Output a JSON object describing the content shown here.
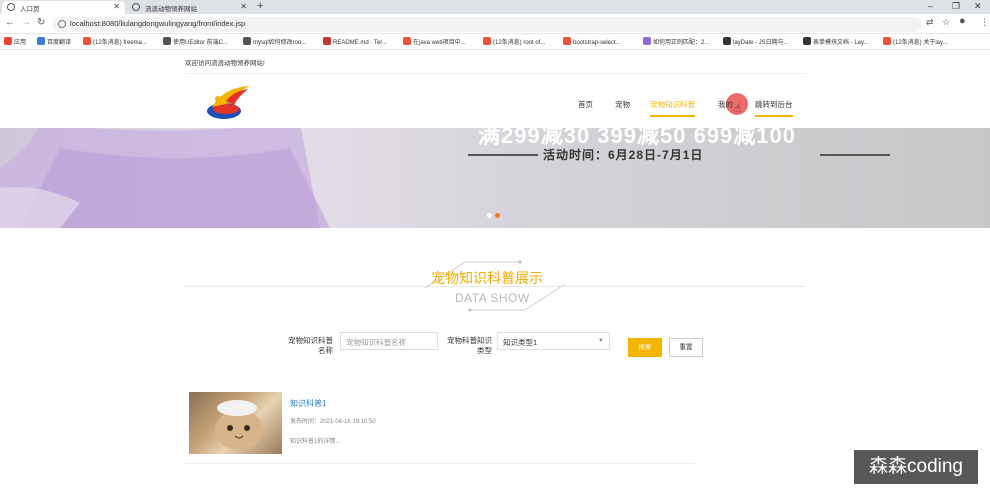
{
  "browser": {
    "tabs": [
      {
        "label": "入口页",
        "active": true
      },
      {
        "label": "流浪动物领养网站",
        "active": false
      }
    ],
    "url": "localhost:8080/liulangdongwulingyang/front/index.jsp",
    "bookmarks": [
      {
        "label": "应用",
        "color": "#ea4335"
      },
      {
        "label": "百度翻译",
        "color": "#3b7bd9"
      },
      {
        "label": "(12条消息) freema...",
        "color": "#e8543c"
      },
      {
        "label": "使用UEditor 前端C...",
        "color": "#555555"
      },
      {
        "label": "mysql如何修改roo...",
        "color": "#555555"
      },
      {
        "label": "README.md · Ter...",
        "color": "#c0392b"
      },
      {
        "label": "在java web项目中...",
        "color": "#e8543c"
      },
      {
        "label": "(12条消息) root of...",
        "color": "#e8543c"
      },
      {
        "label": "bootstrap-select...",
        "color": "#e8543c"
      },
      {
        "label": "如何用正则匹配：2...",
        "color": "#8e6bd6"
      },
      {
        "label": "layDate - JS日期与...",
        "color": "#333333"
      },
      {
        "label": "表单模块文档 - Lay...",
        "color": "#333333"
      },
      {
        "label": "(12条消息) 关于lay...",
        "color": "#e8543c"
      }
    ]
  },
  "header": {
    "welcome": "欢迎访问流浪动物领养网站!",
    "nav": [
      {
        "label": "首页",
        "state": "normal"
      },
      {
        "label": "宠物",
        "state": "normal"
      },
      {
        "label": "宠物知识科普",
        "state": "active"
      },
      {
        "label": "我的",
        "state": "normal"
      },
      {
        "label": "跳转到后台",
        "state": "underline"
      }
    ]
  },
  "banner": {
    "line1": "满299减30  399减50  699减100",
    "line2": "活动时间：6月28日-7月1日"
  },
  "section": {
    "title": "宠物知识科普展示",
    "subtitle": "DATA SHOW"
  },
  "search": {
    "name_label": "宠物知识科普名称",
    "name_placeholder": "宠物知识科普名称",
    "type_label": "宠物科普知识类型",
    "type_value": "知识类型1",
    "search_button": "搜索",
    "reset_button": "重置"
  },
  "items": [
    {
      "title": "知识科普1",
      "date": "发布时间：2021-04-16 19:10:50",
      "desc": "知识科普1的详情..."
    }
  ],
  "watermark": "森森coding",
  "colors": {
    "accent": "#f5b400",
    "link": "#2a7fd4"
  }
}
